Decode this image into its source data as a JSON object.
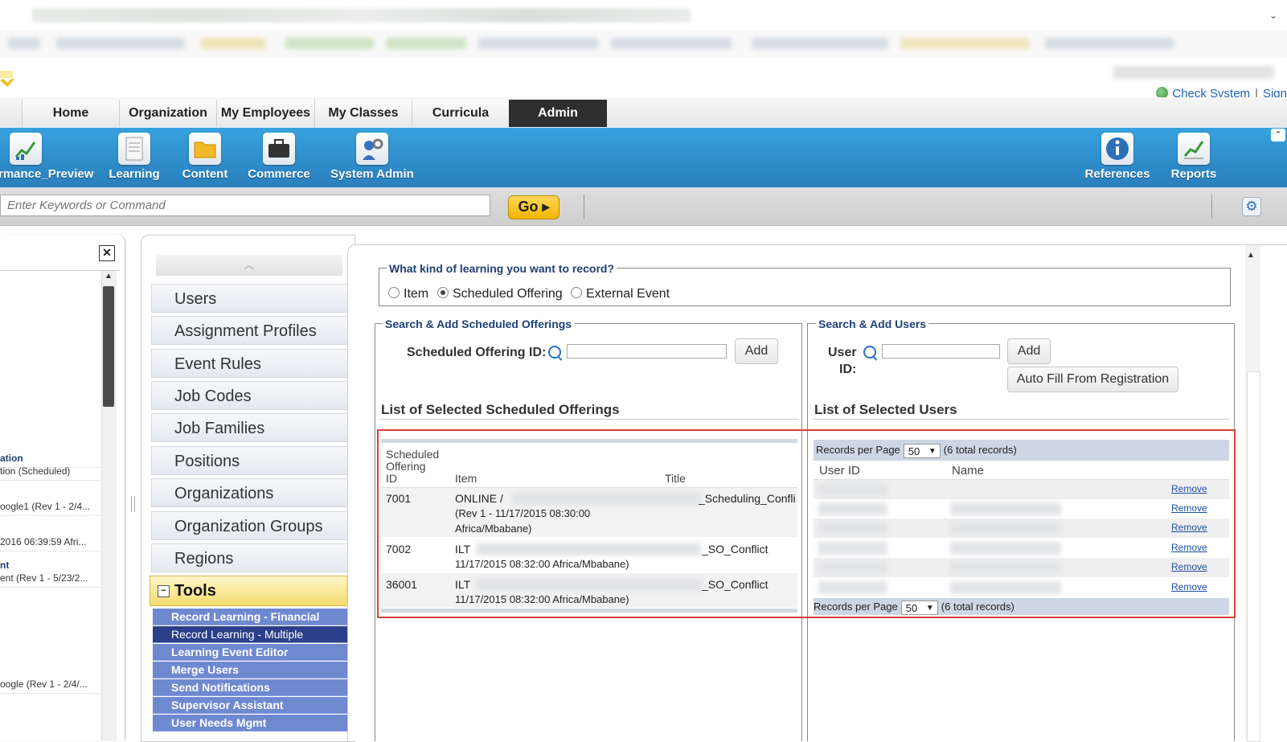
{
  "browser": {
    "dropdown_caret": "⌄"
  },
  "top_links": {
    "check_system": "Check System",
    "separator": "|",
    "sign": "Sign"
  },
  "main_nav": {
    "tabs": [
      {
        "label": "Home",
        "active": false
      },
      {
        "label": "Organization",
        "active": false
      },
      {
        "label": "My Employees",
        "active": false
      },
      {
        "label": "My Classes",
        "active": false
      },
      {
        "label": "Curricula",
        "active": false
      },
      {
        "label": "Admin",
        "active": true
      }
    ]
  },
  "toolbar": {
    "items": [
      {
        "label": "rmance_Preview",
        "icon": "chart-icon"
      },
      {
        "label": "Learning",
        "icon": "document-icon"
      },
      {
        "label": "Content",
        "icon": "folder-icon"
      },
      {
        "label": "Commerce",
        "icon": "briefcase-icon"
      },
      {
        "label": "System Admin",
        "icon": "admin-gear-icon"
      },
      {
        "label": "References",
        "icon": "info-icon"
      },
      {
        "label": "Reports",
        "icon": "report-chart-icon"
      }
    ],
    "collapse_glyph": "⌃"
  },
  "search": {
    "placeholder": "Enter Keywords or Command",
    "go_label": "Go ▸",
    "settings_glyph": "⚙"
  },
  "left_panel": {
    "close_glyph": "✕",
    "items": [
      {
        "bold": "ation",
        "text": ""
      },
      {
        "bold": "",
        "text": "tion (Scheduled)"
      },
      {
        "bold": "",
        "text": "oogle1 (Rev 1 - 2/4..."
      },
      {
        "bold": "",
        "text": "2016 06:39:59 Afri..."
      },
      {
        "bold": "nt",
        "text": ""
      },
      {
        "bold": "",
        "text": "ent (Rev 1 - 5/23/2..."
      },
      {
        "bold": "",
        "text": "oogle (Rev 1 - 2/4/..."
      }
    ]
  },
  "admin_menu": {
    "items": [
      "Users",
      "Assignment Profiles",
      "Event Rules",
      "Job Codes",
      "Job Families",
      "Positions",
      "Organizations",
      "Organization Groups",
      "Regions"
    ],
    "tools_label": "Tools",
    "tools_toggle": "−",
    "tools_items": [
      {
        "label": "Record Learning - Financial",
        "selected": false
      },
      {
        "label": "Record Learning - Multiple",
        "selected": true
      },
      {
        "label": "Learning Event Editor",
        "selected": false
      },
      {
        "label": "Merge Users",
        "selected": false
      },
      {
        "label": "Send Notifications",
        "selected": false
      },
      {
        "label": "Supervisor Assistant",
        "selected": false
      },
      {
        "label": "User Needs Mgmt",
        "selected": false
      }
    ]
  },
  "learning_kind": {
    "legend": "What kind of learning you want to record?",
    "options": [
      {
        "label": "Item",
        "checked": false
      },
      {
        "label": "Scheduled Offering",
        "checked": true
      },
      {
        "label": "External Event",
        "checked": false
      }
    ]
  },
  "offerings": {
    "legend": "Search & Add Scheduled Offerings",
    "id_label": "Scheduled Offering ID:",
    "add_label": "Add",
    "list_title": "List of Selected Scheduled Offerings",
    "columns": {
      "id_line1": "Scheduled",
      "id_line2": "Offering",
      "id_line3": "ID",
      "item": "Item",
      "title": "Title"
    },
    "rows": [
      {
        "id": "7001",
        "item": "ONLINE /",
        "title": "_Scheduling_Confli",
        "line2": "(Rev 1 - 11/17/2015 08:30:00",
        "line3": "Africa/Mbabane)"
      },
      {
        "id": "7002",
        "item": "ILT",
        "title": "_SO_Conflict",
        "line2": "11/17/2015 08:32:00 Africa/Mbabane)",
        "line3": ""
      },
      {
        "id": "36001",
        "item": "ILT",
        "title": "_SO_Conflict",
        "line2": "11/17/2015 08:32:00 Africa/Mbabane)",
        "line3": ""
      }
    ]
  },
  "users": {
    "legend": "Search & Add Users",
    "id_label_1": "User",
    "id_label_2": "ID:",
    "add_label": "Add",
    "autofill_label": "Auto Fill From Registration",
    "list_title": "List of Selected Users",
    "records_per_page_label": "Records per Page",
    "records_per_page_value": "50",
    "total_records": "(6 total records)",
    "columns": {
      "user_id": "User ID",
      "name": "Name"
    },
    "remove_label": "Remove",
    "row_count": 6
  }
}
